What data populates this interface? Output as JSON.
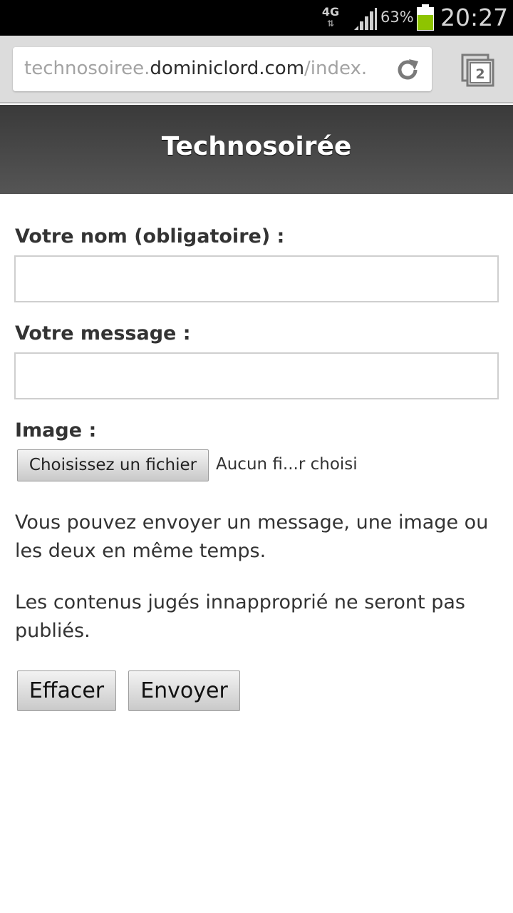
{
  "status_bar": {
    "network": "4G",
    "battery_percent": "63%",
    "battery_level": 0.63,
    "time": "20:27",
    "icons": [
      "network-4g-icon",
      "signal-icon",
      "battery-icon"
    ],
    "battery_color": "#8ec400"
  },
  "browser": {
    "url": {
      "prefix": "technosoiree.",
      "host": "dominiclord.com",
      "path": "/index."
    },
    "tab_count": "2",
    "icons": [
      "reload-icon",
      "tabs-icon"
    ]
  },
  "page": {
    "title": "Technosoirée",
    "form": {
      "name_label": "Votre nom (obligatoire) :",
      "name_value": "",
      "message_label": "Votre message :",
      "message_value": "",
      "image_label": "Image :",
      "file_button": "Choisissez un fichier",
      "file_status": "Aucun fi...r choisi"
    },
    "info": [
      "Vous pouvez envoyer un message, une image ou les deux en même temps.",
      "Les contenus jugés innapproprié ne seront pas publiés."
    ],
    "buttons": {
      "clear": "Effacer",
      "send": "Envoyer"
    }
  }
}
